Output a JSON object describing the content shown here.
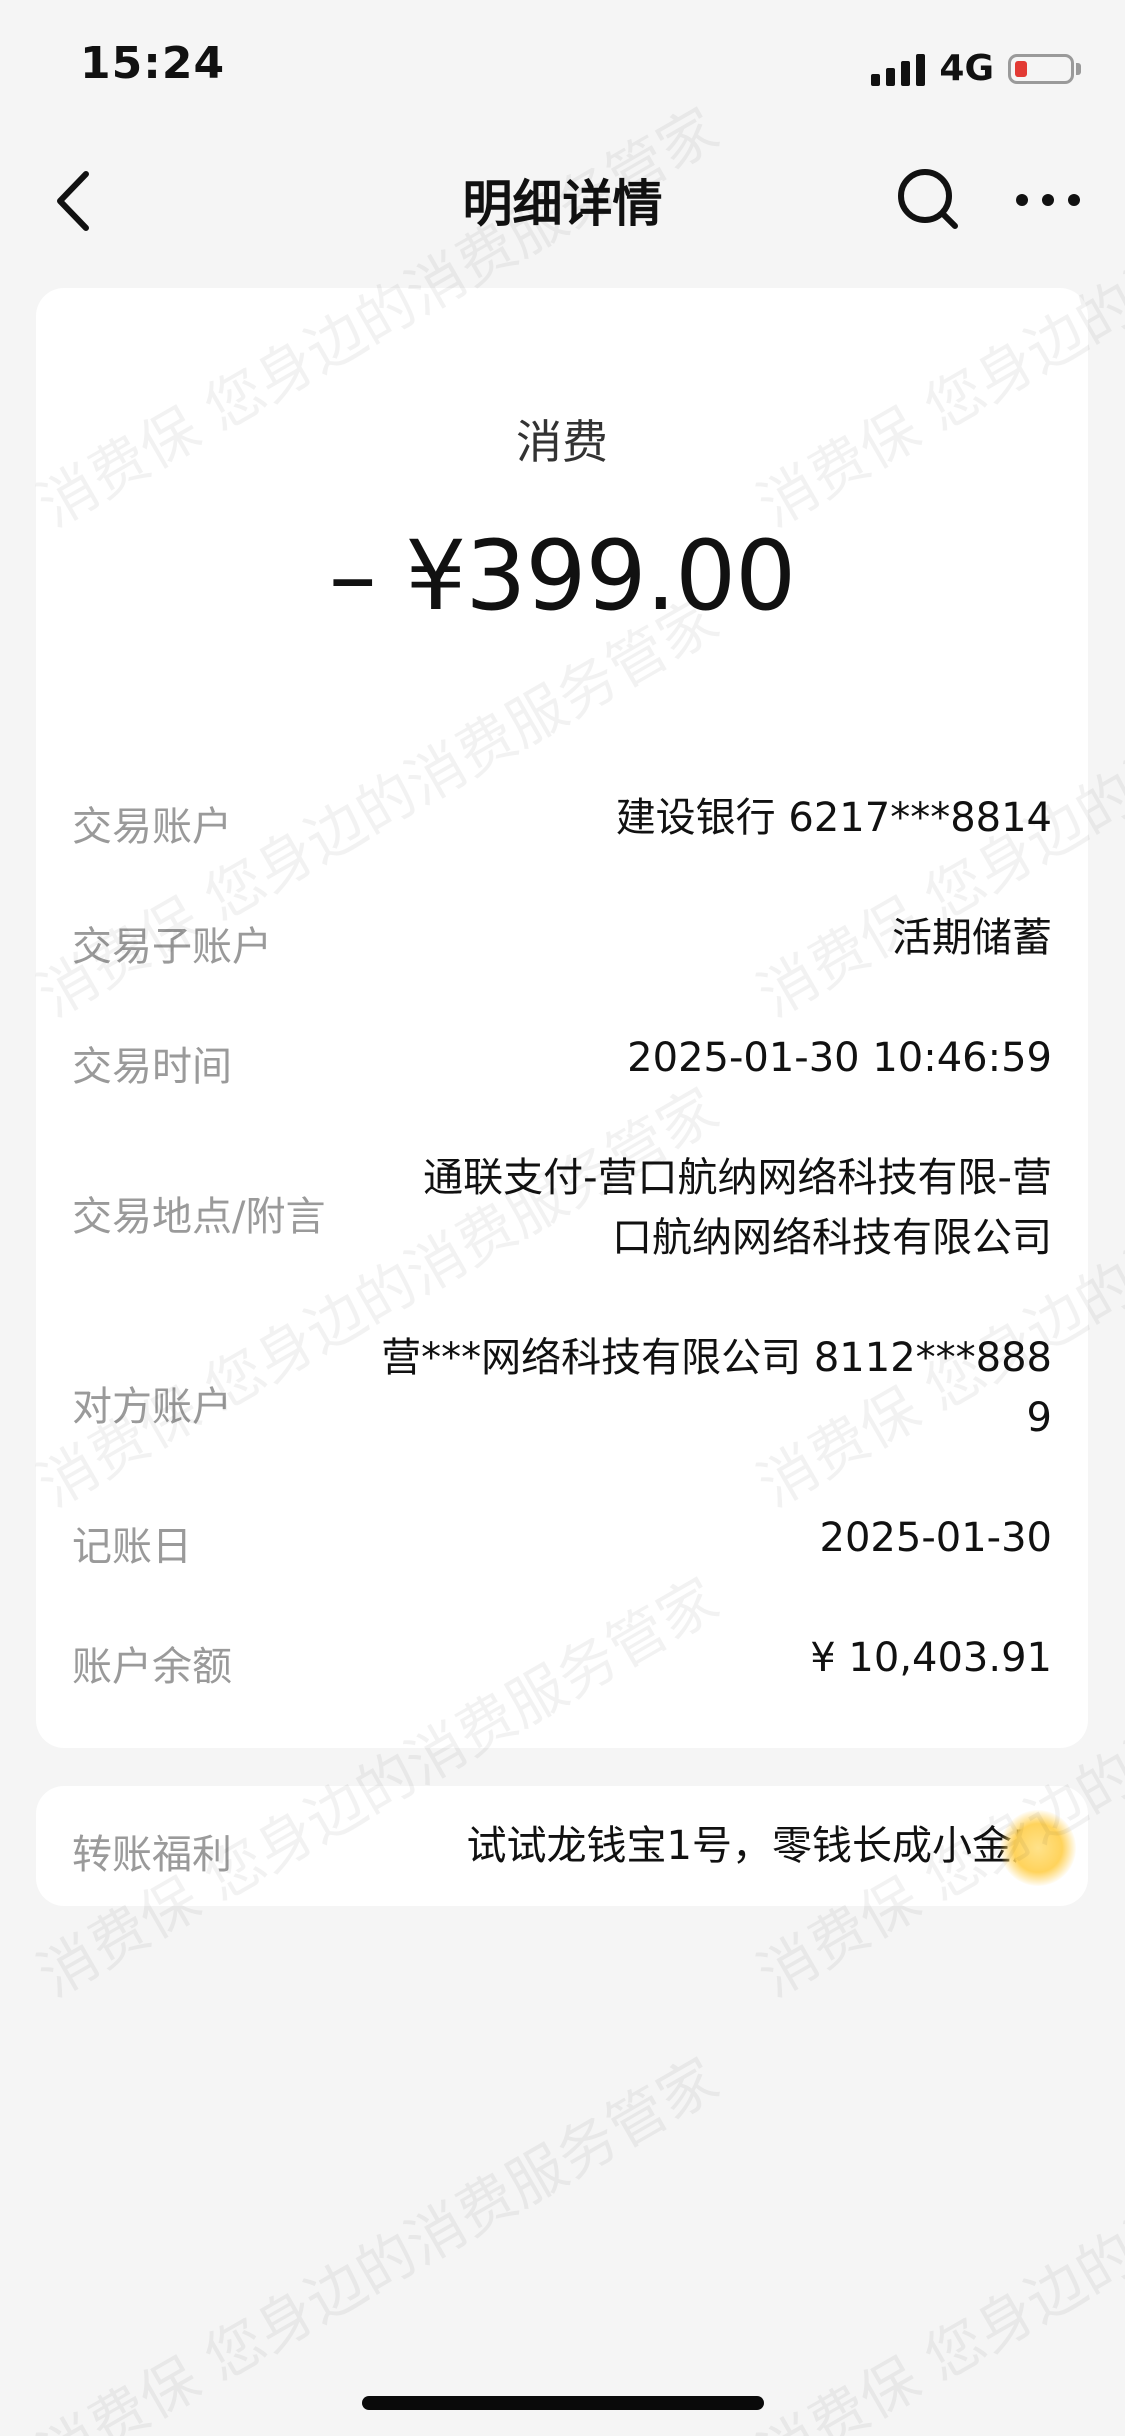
{
  "status_bar": {
    "time": "15:24",
    "network": "4G",
    "battery_color": "#e23a34"
  },
  "nav": {
    "title": "明细详情",
    "back_icon": "chevron-left-icon",
    "search_icon": "search-icon",
    "more_icon": "more-icon"
  },
  "transaction": {
    "type": "消费",
    "amount": "– ¥399.00",
    "rows": [
      {
        "label": "交易账户",
        "value": "建设银行 6217***8814"
      },
      {
        "label": "交易子账户",
        "value": "活期储蓄"
      },
      {
        "label": "交易时间",
        "value": "2025-01-30 10:46:59"
      },
      {
        "label": "交易地点/附言",
        "value_lines": [
          "通联支付-营口航纳网络科技有限-营",
          "口航纳网络科技有限公司"
        ]
      },
      {
        "label": "对方账户",
        "value_lines": [
          "营***网络科技有限公司 8112***888",
          "9"
        ]
      },
      {
        "label": "记账日",
        "value": "2025-01-30"
      },
      {
        "label": "账户余额",
        "value": "¥ 10,403.91"
      }
    ]
  },
  "benefit": {
    "label": "转账福利",
    "value": "试试龙钱宝1号，零钱长成小金库"
  },
  "watermark": "消费保 您身边的消费服务管家"
}
